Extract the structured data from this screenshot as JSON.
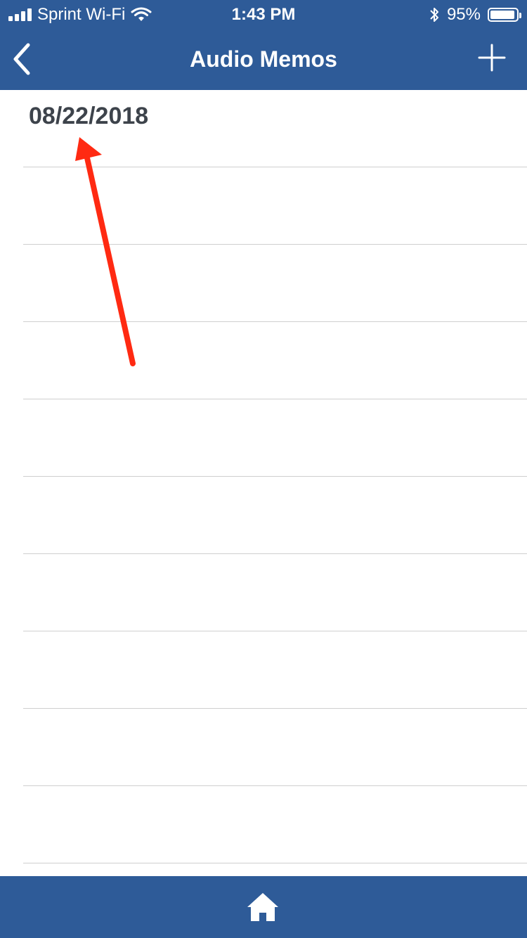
{
  "status_bar": {
    "carrier": "Sprint Wi-Fi",
    "time": "1:43 PM",
    "battery_percent_label": "95%",
    "battery_level": 0.95,
    "icons": [
      "signal-icon",
      "wifi-icon",
      "bluetooth-icon",
      "battery-icon"
    ]
  },
  "nav": {
    "title": "Audio Memos",
    "back_icon": "chevron-left-icon",
    "add_icon": "plus-icon"
  },
  "list": {
    "date_header": "08/22/2018",
    "rows": [
      "",
      "",
      "",
      "",
      "",
      "",
      "",
      "",
      "",
      ""
    ]
  },
  "bottom_bar": {
    "home_icon": "home-icon"
  },
  "annotation": {
    "type": "arrow",
    "color": "#ff2a12"
  },
  "colors": {
    "brand_blue": "#2e5b98",
    "text_dark": "#3d434b",
    "divider": "#cfcfcf"
  }
}
